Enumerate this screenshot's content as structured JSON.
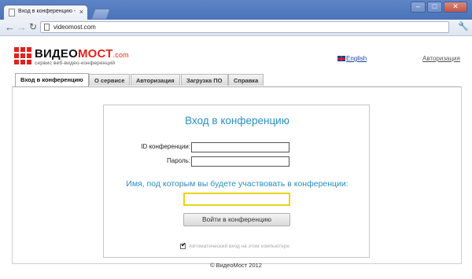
{
  "browser": {
    "tab_title": "Вход в конференцию - Сист",
    "tab_close": "×",
    "url": "videomost.com",
    "window_controls": [
      "–",
      "□",
      "✕"
    ]
  },
  "header": {
    "logo_part1": "ВИДЕО",
    "logo_part2": "МОСТ",
    "logo_suffix": ".com",
    "tagline": "сервис веб-видео-конференций",
    "language_link": "English",
    "auth_link": "Авторизация"
  },
  "nav": {
    "tabs": [
      {
        "label": "Вход в конференцию",
        "active": true
      },
      {
        "label": "О сервисе",
        "active": false
      },
      {
        "label": "Авторизация",
        "active": false
      },
      {
        "label": "Загрузка ПО",
        "active": false
      },
      {
        "label": "Справка",
        "active": false
      }
    ]
  },
  "login": {
    "title": "Вход в конференцию",
    "conference_id_label": "ID конференции:",
    "conference_id_value": "",
    "password_label": "Пароль:",
    "password_value": "",
    "name_prompt": "Имя, под которым вы будете участвовать в конференции:",
    "name_value": "",
    "submit_label": "Войти в конференцию",
    "auto_login_checked": true,
    "auto_login_label": "Автоматический вход на этом компьютере"
  },
  "footer": {
    "copyright": "© ВидеоМост 2012"
  },
  "colors": {
    "accent_blue": "#2a8ec4",
    "brand_red": "#e0231c",
    "focus_yellow": "#e8d418"
  },
  "icons": [
    "page-icon",
    "back-arrow-icon",
    "forward-arrow-icon",
    "reload-icon",
    "document-icon",
    "wrench-icon",
    "uk-flag-icon",
    "checkmark-icon"
  ]
}
